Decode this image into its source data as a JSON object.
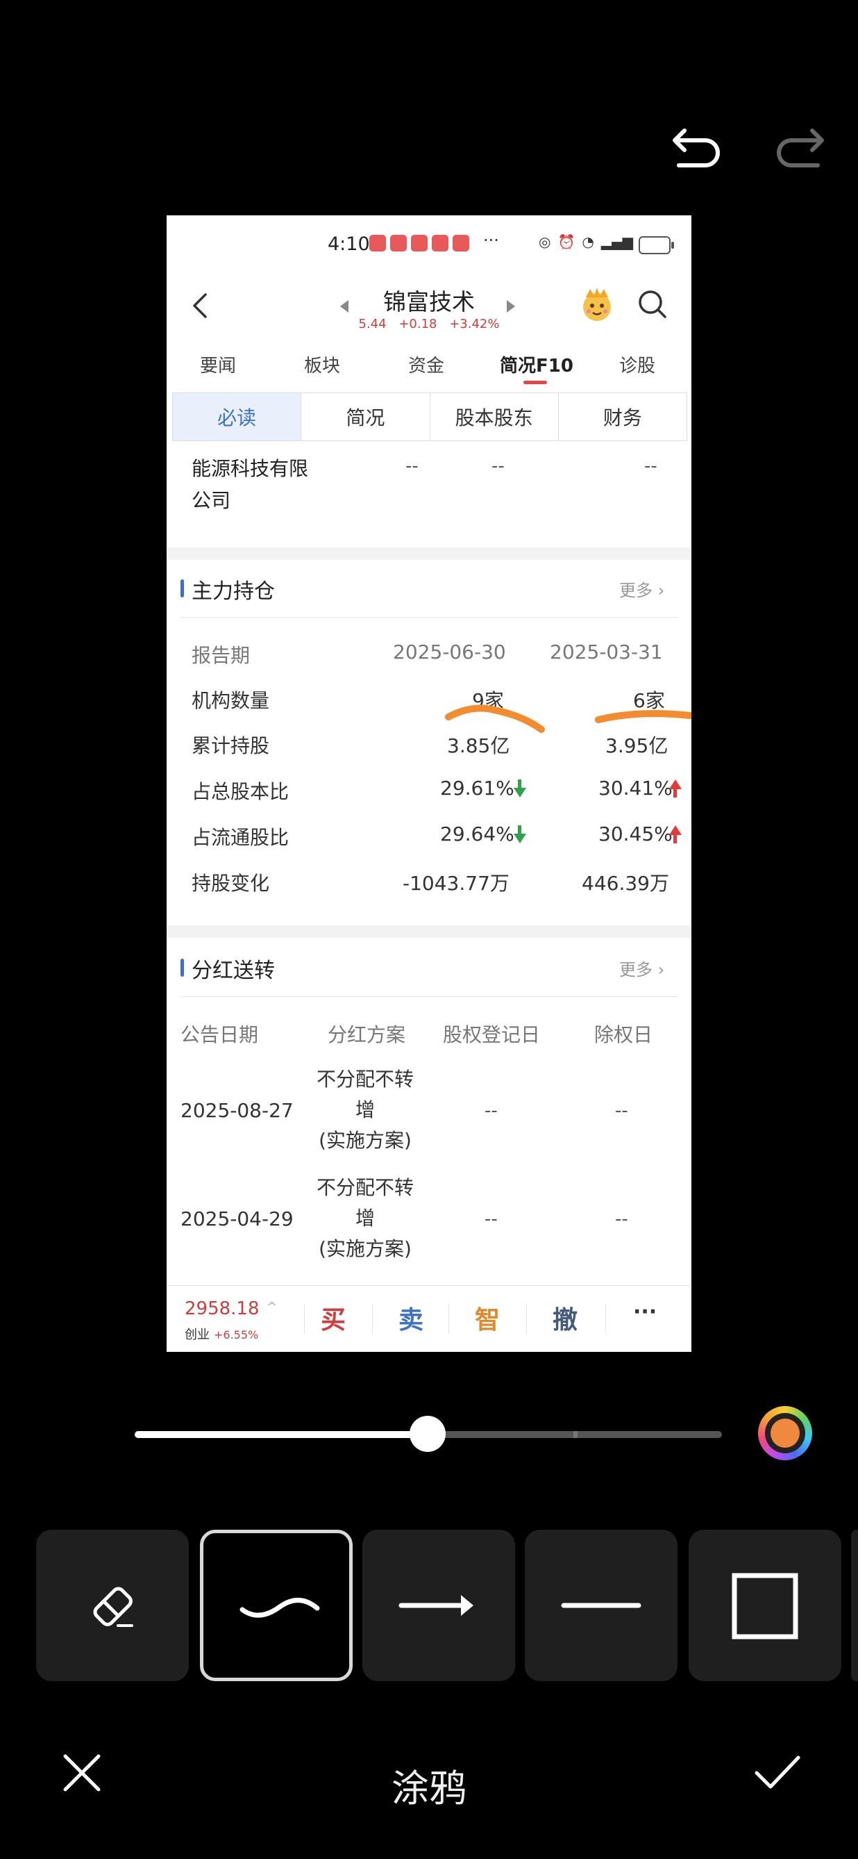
{
  "phone": {
    "status": {
      "time": "4:10",
      "dots": "···"
    },
    "stock": {
      "name": "锦富技术",
      "price": "5.44",
      "change": "+0.18",
      "pct": "+3.42%"
    },
    "tabs": [
      {
        "label": "要闻",
        "active": false
      },
      {
        "label": "板块",
        "active": false
      },
      {
        "label": "资金",
        "active": false
      },
      {
        "label": "简况F10",
        "active": true
      },
      {
        "label": "诊股",
        "active": false
      }
    ],
    "subtabs": [
      {
        "label": "必读",
        "active": true
      },
      {
        "label": "简况",
        "active": false
      },
      {
        "label": "股本股东",
        "active": false
      },
      {
        "label": "财务",
        "active": false
      }
    ],
    "company_row": {
      "name_line1": "能源科技有限",
      "name_line2": "公司",
      "v1": "--",
      "v2": "--",
      "v3": "--"
    },
    "holdings": {
      "title": "主力持仓",
      "more": "更多",
      "header": {
        "label": "报告期",
        "col1": "2025-06-30",
        "col2": "2025-03-31"
      },
      "rows": [
        {
          "label": "机构数量",
          "col1": "9家",
          "col2": "6家"
        },
        {
          "label": "累计持股",
          "col1": "3.85亿",
          "col2": "3.95亿"
        },
        {
          "label": "占总股本比",
          "col1": "29.61%",
          "col1_trend": "down",
          "col2": "30.41%",
          "col2_trend": "up"
        },
        {
          "label": "占流通股比",
          "col1": "29.64%",
          "col1_trend": "down",
          "col2": "30.45%",
          "col2_trend": "up"
        },
        {
          "label": "持股变化",
          "col1": "-1043.77万",
          "col2": "446.39万"
        }
      ]
    },
    "dividend": {
      "title": "分红送转",
      "more": "更多",
      "headers": [
        "公告日期",
        "分红方案",
        "股权登记日",
        "除权日"
      ],
      "rows": [
        {
          "date": "2025-08-27",
          "plan1": "不分配不转",
          "plan2": "增",
          "plan3": "(实施方案)",
          "reg": "--",
          "ex": "--"
        },
        {
          "date": "2025-04-29",
          "plan1": "不分配不转",
          "plan2": "增",
          "plan3": "(实施方案)",
          "reg": "--",
          "ex": "--"
        }
      ]
    },
    "bottom": {
      "index_value": "2958.18",
      "index_name": "创业",
      "index_change": "+6.55%",
      "buy": "买",
      "sell": "卖",
      "smart": "智",
      "cancel": "撤",
      "more": "···"
    }
  },
  "editor": {
    "title": "涂鸦",
    "brush_size_fraction": 0.5,
    "tools": [
      "eraser",
      "freehand",
      "arrow",
      "line",
      "rectangle"
    ],
    "selected_tool": "freehand",
    "color": "#f0883e"
  }
}
